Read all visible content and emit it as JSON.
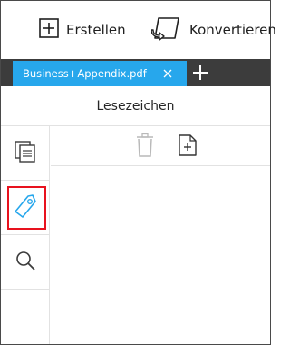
{
  "toolbar": {
    "create_label": "Erstellen",
    "convert_label": "Konvertieren"
  },
  "tabs": [
    {
      "label": "Business+Appendix.pdf",
      "active": true
    }
  ],
  "panel": {
    "title": "Lesezeichen"
  },
  "sidebar": {
    "items": [
      {
        "icon": "thumbnails-icon"
      },
      {
        "icon": "bookmark-tag-icon",
        "selected": true
      },
      {
        "icon": "search-icon"
      }
    ]
  },
  "colors": {
    "tab_active": "#27a7ec",
    "tabstrip_bg": "#3c3c3c",
    "highlight_border": "#e8121e",
    "bookmark_icon": "#27a7ec"
  }
}
